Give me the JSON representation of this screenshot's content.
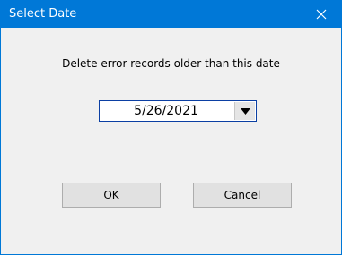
{
  "window": {
    "title": "Select Date",
    "accent_color": "#0078d7",
    "close_icon": "close-icon"
  },
  "dialog": {
    "prompt": "Delete error records older than this date",
    "date_value": "5/26/2021",
    "dropdown_icon": "chevron-down-icon",
    "ok": {
      "accel": "O",
      "rest": "K"
    },
    "cancel": {
      "accel": "C",
      "rest": "ancel"
    }
  }
}
